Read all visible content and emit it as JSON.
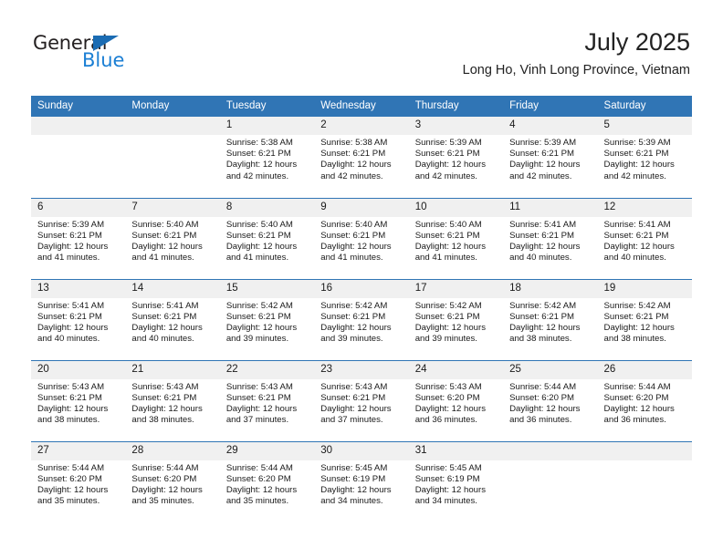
{
  "logo": {
    "word1": "General",
    "word2": "Blue",
    "triangle_icon": "triangle-icon",
    "blue": "#1b7fd4",
    "dark": "#231f20"
  },
  "header": {
    "title": "July 2025",
    "subtitle": "Long Ho, Vinh Long Province, Vietnam"
  },
  "theme": {
    "header_blue": "#3075b5",
    "daynum_band": "#f0f0f0"
  },
  "calendar": {
    "weekday_headers": [
      "Sunday",
      "Monday",
      "Tuesday",
      "Wednesday",
      "Thursday",
      "Friday",
      "Saturday"
    ],
    "weeks": [
      [
        {
          "day": "",
          "empty": true
        },
        {
          "day": "",
          "empty": true
        },
        {
          "day": "1",
          "sunrise": "Sunrise: 5:38 AM",
          "sunset": "Sunset: 6:21 PM",
          "daylight1": "Daylight: 12 hours",
          "daylight2": "and 42 minutes."
        },
        {
          "day": "2",
          "sunrise": "Sunrise: 5:38 AM",
          "sunset": "Sunset: 6:21 PM",
          "daylight1": "Daylight: 12 hours",
          "daylight2": "and 42 minutes."
        },
        {
          "day": "3",
          "sunrise": "Sunrise: 5:39 AM",
          "sunset": "Sunset: 6:21 PM",
          "daylight1": "Daylight: 12 hours",
          "daylight2": "and 42 minutes."
        },
        {
          "day": "4",
          "sunrise": "Sunrise: 5:39 AM",
          "sunset": "Sunset: 6:21 PM",
          "daylight1": "Daylight: 12 hours",
          "daylight2": "and 42 minutes."
        },
        {
          "day": "5",
          "sunrise": "Sunrise: 5:39 AM",
          "sunset": "Sunset: 6:21 PM",
          "daylight1": "Daylight: 12 hours",
          "daylight2": "and 42 minutes."
        }
      ],
      [
        {
          "day": "6",
          "sunrise": "Sunrise: 5:39 AM",
          "sunset": "Sunset: 6:21 PM",
          "daylight1": "Daylight: 12 hours",
          "daylight2": "and 41 minutes."
        },
        {
          "day": "7",
          "sunrise": "Sunrise: 5:40 AM",
          "sunset": "Sunset: 6:21 PM",
          "daylight1": "Daylight: 12 hours",
          "daylight2": "and 41 minutes."
        },
        {
          "day": "8",
          "sunrise": "Sunrise: 5:40 AM",
          "sunset": "Sunset: 6:21 PM",
          "daylight1": "Daylight: 12 hours",
          "daylight2": "and 41 minutes."
        },
        {
          "day": "9",
          "sunrise": "Sunrise: 5:40 AM",
          "sunset": "Sunset: 6:21 PM",
          "daylight1": "Daylight: 12 hours",
          "daylight2": "and 41 minutes."
        },
        {
          "day": "10",
          "sunrise": "Sunrise: 5:40 AM",
          "sunset": "Sunset: 6:21 PM",
          "daylight1": "Daylight: 12 hours",
          "daylight2": "and 41 minutes."
        },
        {
          "day": "11",
          "sunrise": "Sunrise: 5:41 AM",
          "sunset": "Sunset: 6:21 PM",
          "daylight1": "Daylight: 12 hours",
          "daylight2": "and 40 minutes."
        },
        {
          "day": "12",
          "sunrise": "Sunrise: 5:41 AM",
          "sunset": "Sunset: 6:21 PM",
          "daylight1": "Daylight: 12 hours",
          "daylight2": "and 40 minutes."
        }
      ],
      [
        {
          "day": "13",
          "sunrise": "Sunrise: 5:41 AM",
          "sunset": "Sunset: 6:21 PM",
          "daylight1": "Daylight: 12 hours",
          "daylight2": "and 40 minutes."
        },
        {
          "day": "14",
          "sunrise": "Sunrise: 5:41 AM",
          "sunset": "Sunset: 6:21 PM",
          "daylight1": "Daylight: 12 hours",
          "daylight2": "and 40 minutes."
        },
        {
          "day": "15",
          "sunrise": "Sunrise: 5:42 AM",
          "sunset": "Sunset: 6:21 PM",
          "daylight1": "Daylight: 12 hours",
          "daylight2": "and 39 minutes."
        },
        {
          "day": "16",
          "sunrise": "Sunrise: 5:42 AM",
          "sunset": "Sunset: 6:21 PM",
          "daylight1": "Daylight: 12 hours",
          "daylight2": "and 39 minutes."
        },
        {
          "day": "17",
          "sunrise": "Sunrise: 5:42 AM",
          "sunset": "Sunset: 6:21 PM",
          "daylight1": "Daylight: 12 hours",
          "daylight2": "and 39 minutes."
        },
        {
          "day": "18",
          "sunrise": "Sunrise: 5:42 AM",
          "sunset": "Sunset: 6:21 PM",
          "daylight1": "Daylight: 12 hours",
          "daylight2": "and 38 minutes."
        },
        {
          "day": "19",
          "sunrise": "Sunrise: 5:42 AM",
          "sunset": "Sunset: 6:21 PM",
          "daylight1": "Daylight: 12 hours",
          "daylight2": "and 38 minutes."
        }
      ],
      [
        {
          "day": "20",
          "sunrise": "Sunrise: 5:43 AM",
          "sunset": "Sunset: 6:21 PM",
          "daylight1": "Daylight: 12 hours",
          "daylight2": "and 38 minutes."
        },
        {
          "day": "21",
          "sunrise": "Sunrise: 5:43 AM",
          "sunset": "Sunset: 6:21 PM",
          "daylight1": "Daylight: 12 hours",
          "daylight2": "and 38 minutes."
        },
        {
          "day": "22",
          "sunrise": "Sunrise: 5:43 AM",
          "sunset": "Sunset: 6:21 PM",
          "daylight1": "Daylight: 12 hours",
          "daylight2": "and 37 minutes."
        },
        {
          "day": "23",
          "sunrise": "Sunrise: 5:43 AM",
          "sunset": "Sunset: 6:21 PM",
          "daylight1": "Daylight: 12 hours",
          "daylight2": "and 37 minutes."
        },
        {
          "day": "24",
          "sunrise": "Sunrise: 5:43 AM",
          "sunset": "Sunset: 6:20 PM",
          "daylight1": "Daylight: 12 hours",
          "daylight2": "and 36 minutes."
        },
        {
          "day": "25",
          "sunrise": "Sunrise: 5:44 AM",
          "sunset": "Sunset: 6:20 PM",
          "daylight1": "Daylight: 12 hours",
          "daylight2": "and 36 minutes."
        },
        {
          "day": "26",
          "sunrise": "Sunrise: 5:44 AM",
          "sunset": "Sunset: 6:20 PM",
          "daylight1": "Daylight: 12 hours",
          "daylight2": "and 36 minutes."
        }
      ],
      [
        {
          "day": "27",
          "sunrise": "Sunrise: 5:44 AM",
          "sunset": "Sunset: 6:20 PM",
          "daylight1": "Daylight: 12 hours",
          "daylight2": "and 35 minutes."
        },
        {
          "day": "28",
          "sunrise": "Sunrise: 5:44 AM",
          "sunset": "Sunset: 6:20 PM",
          "daylight1": "Daylight: 12 hours",
          "daylight2": "and 35 minutes."
        },
        {
          "day": "29",
          "sunrise": "Sunrise: 5:44 AM",
          "sunset": "Sunset: 6:20 PM",
          "daylight1": "Daylight: 12 hours",
          "daylight2": "and 35 minutes."
        },
        {
          "day": "30",
          "sunrise": "Sunrise: 5:45 AM",
          "sunset": "Sunset: 6:19 PM",
          "daylight1": "Daylight: 12 hours",
          "daylight2": "and 34 minutes."
        },
        {
          "day": "31",
          "sunrise": "Sunrise: 5:45 AM",
          "sunset": "Sunset: 6:19 PM",
          "daylight1": "Daylight: 12 hours",
          "daylight2": "and 34 minutes."
        },
        {
          "day": "",
          "empty": true
        },
        {
          "day": "",
          "empty": true
        }
      ]
    ]
  }
}
